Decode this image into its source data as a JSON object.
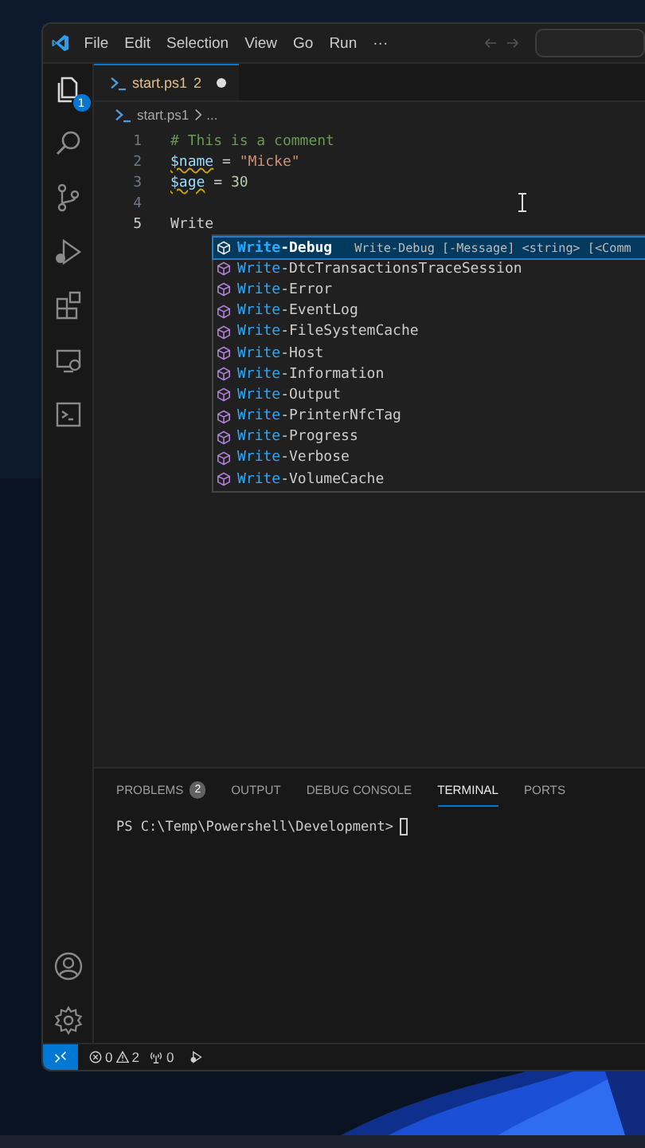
{
  "menu": [
    "File",
    "Edit",
    "Selection",
    "View",
    "Go",
    "Run",
    "···"
  ],
  "activity_bar": {
    "explorer_badge": "1"
  },
  "tab": {
    "label": "start.ps1",
    "problems": "2",
    "modified": true,
    "selected": true
  },
  "breadcrumb": [
    "start.ps1",
    "..."
  ],
  "code_lines": [
    {
      "number": "1",
      "current": false,
      "tokens": [
        {
          "kind": "comment",
          "text": "# This is a comment",
          "warning": false
        }
      ]
    },
    {
      "number": "2",
      "current": false,
      "tokens": [
        {
          "kind": "variable",
          "text": "$name",
          "warning": true
        },
        {
          "kind": "plain",
          "text": " = ",
          "warning": false
        },
        {
          "kind": "string",
          "text": "\"Micke\"",
          "warning": false
        }
      ]
    },
    {
      "number": "3",
      "current": false,
      "tokens": [
        {
          "kind": "variable",
          "text": "$age",
          "warning": true
        },
        {
          "kind": "plain",
          "text": " = ",
          "warning": false
        },
        {
          "kind": "number",
          "text": "30",
          "warning": false
        }
      ]
    },
    {
      "number": "4",
      "current": false
    },
    {
      "number": "5",
      "current": true,
      "tokens": [
        {
          "kind": "plain",
          "text": "Write",
          "warning": false
        }
      ]
    }
  ],
  "suggestions": [
    {
      "match": "Write",
      "rest": "-Debug",
      "selected": true,
      "detail": "Write-Debug [-Message] <string> [<Comm"
    },
    {
      "match": "Write",
      "rest": "-DtcTransactionsTraceSession",
      "selected": false
    },
    {
      "match": "Write",
      "rest": "-Error",
      "selected": false
    },
    {
      "match": "Write",
      "rest": "-EventLog",
      "selected": false
    },
    {
      "match": "Write",
      "rest": "-FileSystemCache",
      "selected": false
    },
    {
      "match": "Write",
      "rest": "-Host",
      "selected": false
    },
    {
      "match": "Write",
      "rest": "-Information",
      "selected": false
    },
    {
      "match": "Write",
      "rest": "-Output",
      "selected": false
    },
    {
      "match": "Write",
      "rest": "-PrinterNfcTag",
      "selected": false
    },
    {
      "match": "Write",
      "rest": "-Progress",
      "selected": false
    },
    {
      "match": "Write",
      "rest": "-Verbose",
      "selected": false
    },
    {
      "match": "Write",
      "rest": "-VolumeCache",
      "selected": false
    }
  ],
  "panel_tabs": [
    {
      "label": "PROBLEMS",
      "badge": "2",
      "selected": false
    },
    {
      "label": "OUTPUT",
      "selected": false
    },
    {
      "label": "DEBUG CONSOLE",
      "selected": false
    },
    {
      "label": "TERMINAL",
      "selected": true
    },
    {
      "label": "PORTS",
      "selected": false
    }
  ],
  "terminal": {
    "prompt": "PS C:\\Temp\\Powershell\\Development>"
  },
  "status_bar": {
    "errors": "0",
    "warnings": "2",
    "ports": "0"
  }
}
